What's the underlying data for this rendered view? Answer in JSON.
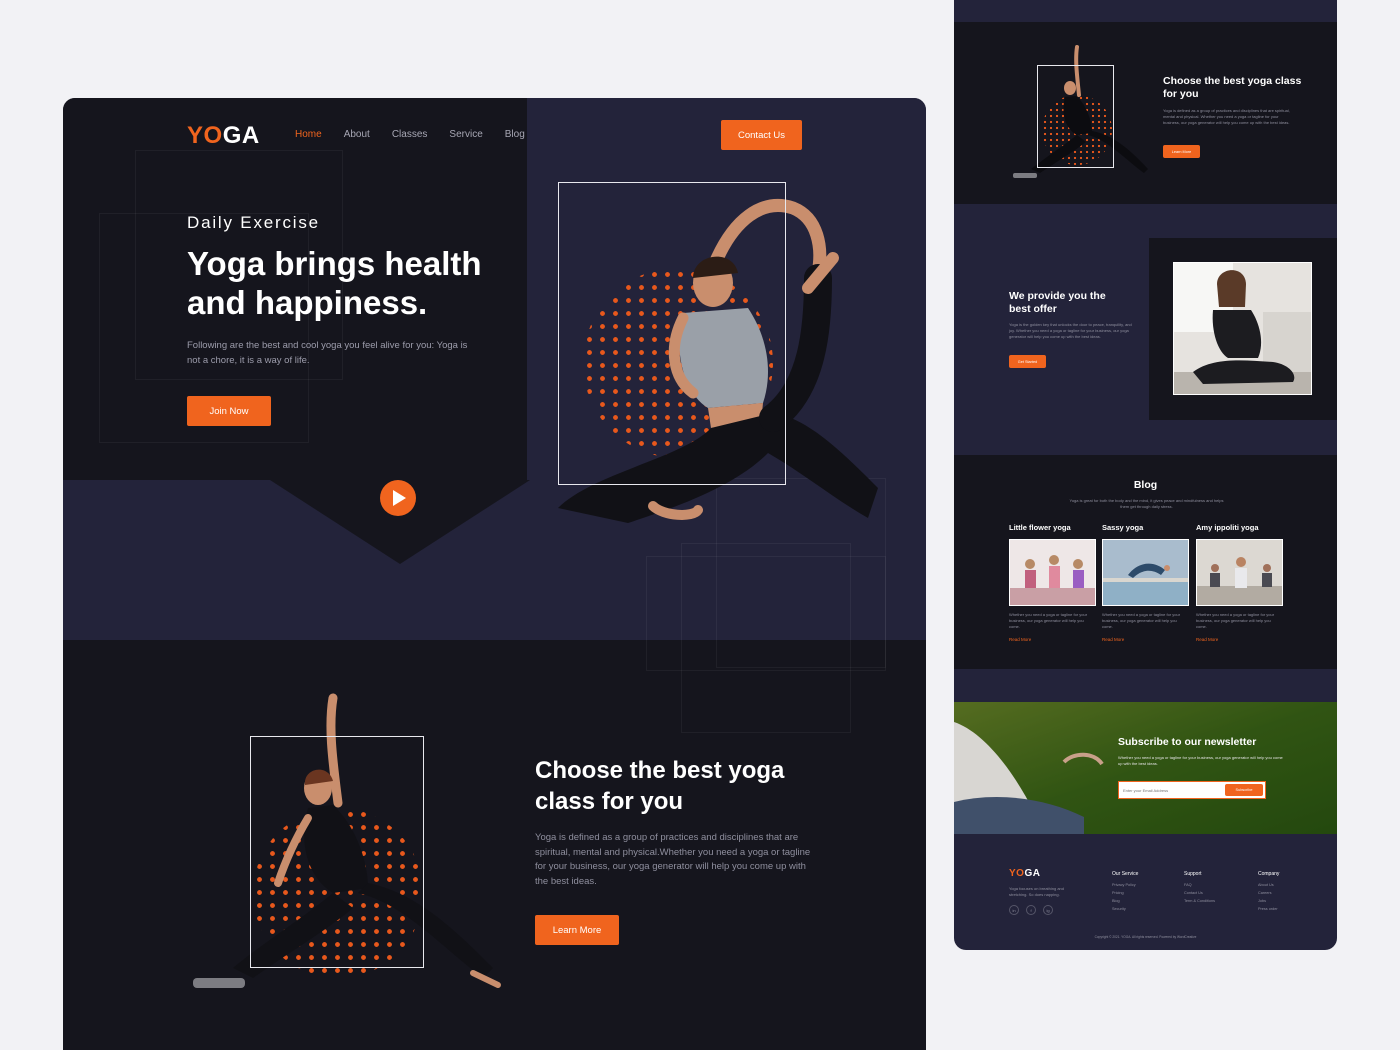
{
  "colors": {
    "accent": "#f0641e",
    "dark": "#15151d",
    "navy": "#23233a"
  },
  "main": {
    "logo": {
      "yo": "YO",
      "ga": "GA"
    },
    "nav": [
      "Home",
      "About",
      "Classes",
      "Service",
      "Blog"
    ],
    "contact_label": "Contact Us",
    "hero": {
      "eyebrow": "Daily Exercise",
      "title": "Yoga brings health and happiness.",
      "text": "Following are the best and cool yoga you feel alive for you: Yoga is not a chore, it is a way of life.",
      "join_label": "Join Now"
    },
    "choose": {
      "title": "Choose the best yoga class for you",
      "text": "Yoga is defined as a group of practices and disciplines that are spiritual, mental and physical.Whether you need a yoga or tagline for your business, our yoga generator will help you come up with the best ideas.",
      "button": "Learn More"
    }
  },
  "side": {
    "choose": {
      "title": "Choose the best yoga class for you",
      "text": "Yoga is defined as a group of practices and disciplines that are spiritual, mental and physical. Whether you need a yoga or tagline for your business, our yoga generator will help you come up with the best ideas.",
      "button": "Learn More"
    },
    "offer": {
      "title": "We provide you the best offer",
      "text": "Yoga is the golden key that unlocks the door to peace, tranquility, and joy. Whether you need a yoga or tagline for your business, our yoga generator will help you come up with the best ideas.",
      "button": "Get Started"
    },
    "blog": {
      "title": "Blog",
      "subtitle": "Yoga is great for both the body and the mind, it gives peace and mindfulness and helps them get through daily stress.",
      "cards": [
        {
          "title": "Little flower yoga",
          "text": "Whether you need a yoga or tagline for your business, our yoga generator will help you come.",
          "link": "Read More"
        },
        {
          "title": "Sassy yoga",
          "text": "Whether you need a yoga or tagline for your business, our yoga generator will help you come.",
          "link": "Read More"
        },
        {
          "title": "Amy ippoliti yoga",
          "text": "Whether you need a yoga or tagline for your business, our yoga generator will help you come.",
          "link": "Read More"
        }
      ]
    },
    "newsletter": {
      "title": "Subscribe to our newsletter",
      "text": "Whether you need a yoga or tagline for your business, our yoga generator will help you come up with the best ideas.",
      "placeholder": "Enter your Email Address",
      "button": "Subscribe"
    },
    "footer": {
      "logo": {
        "yo": "YO",
        "ga": "GA"
      },
      "about": "Yoga focuses on breathing and stretching. So does napping.",
      "social": [
        "in",
        "f",
        "ig"
      ],
      "columns": [
        {
          "head": "Our Service",
          "items": [
            "Privacy Policy",
            "Pricing",
            "Blog",
            "Security"
          ]
        },
        {
          "head": "Support",
          "items": [
            "FAQ",
            "Contact Us",
            "Term & Conditions"
          ]
        },
        {
          "head": "Company",
          "items": [
            "About Us",
            "Careers",
            "Jobs",
            "Press order"
          ]
        }
      ],
      "copyright": "Copyright © 2021. YOGA. All rights reserved. Powered by WordCreative"
    }
  }
}
